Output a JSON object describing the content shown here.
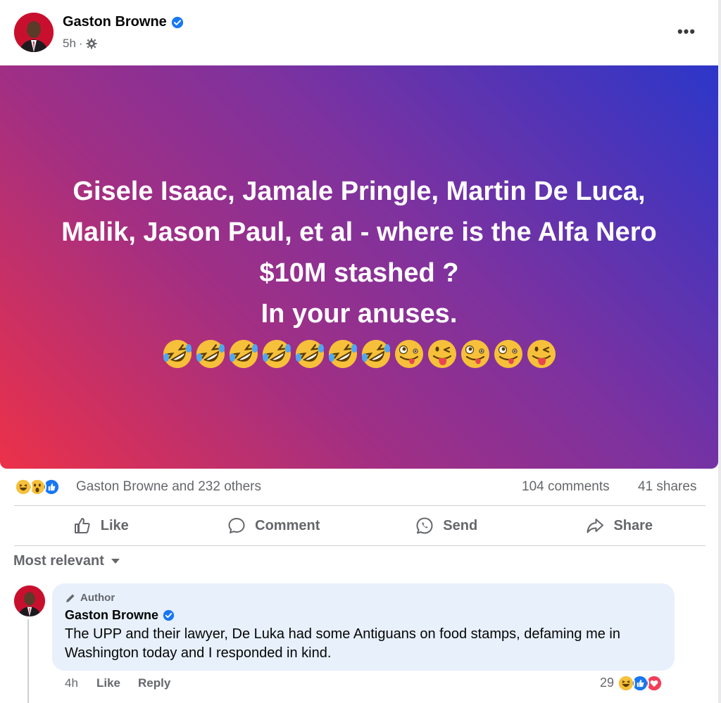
{
  "post": {
    "author": "Gaston Browne",
    "time": "5h",
    "more_label": "•••"
  },
  "banner": {
    "line1": "Gisele Isaac, Jamale Pringle, Martin De Luca,",
    "line2": "Malik, Jason Paul, et al - where is the Alfa Nero",
    "line3": "$10M stashed ?",
    "line4": "In your anuses.",
    "emojis": [
      "rolling-on-floor-laughing",
      "rolling-on-floor-laughing",
      "rolling-on-floor-laughing",
      "rolling-on-floor-laughing",
      "rolling-on-floor-laughing",
      "rolling-on-floor-laughing",
      "rolling-on-floor-laughing",
      "zany-face",
      "winking-tongue-face",
      "zany-face",
      "zany-face",
      "winking-tongue-face"
    ]
  },
  "stats": {
    "reactors": "Gaston Browne and 232 others",
    "comments": "104 comments",
    "shares": "41 shares"
  },
  "actions": {
    "like": "Like",
    "comment": "Comment",
    "send": "Send",
    "share": "Share"
  },
  "sort_label": "Most relevant",
  "comment": {
    "badge": "Author",
    "author": "Gaston Browne",
    "text": "The UPP and their lawyer, De Luka had some Antiguans on food stamps, defaming me in Washington today and I responded in kind.",
    "time": "4h",
    "like": "Like",
    "reply": "Reply",
    "reaction_count": "29"
  },
  "colors": {
    "facebook_blue": "#1877f2",
    "muted_text": "#65676b",
    "bubble_bg": "#e7f0fb"
  }
}
